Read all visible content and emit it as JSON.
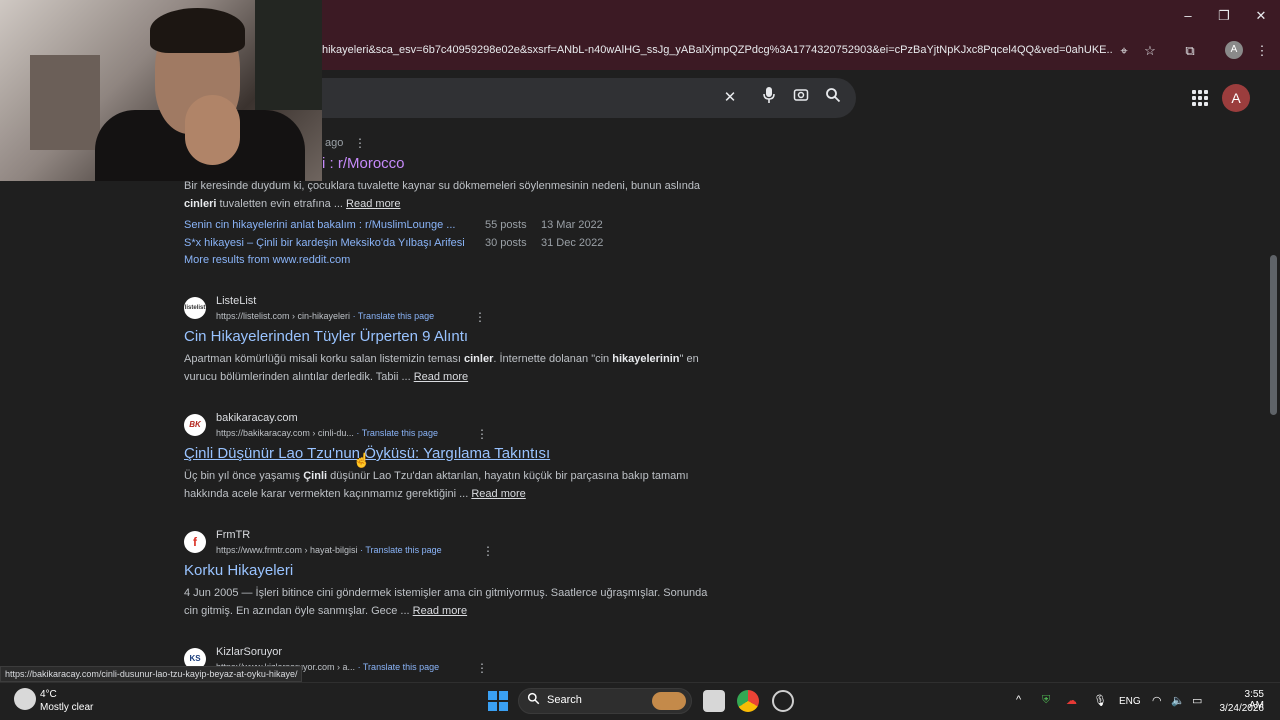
{
  "browser": {
    "url": "hikayeleri&sca_esv=6b7c40959298e02e&sxsrf=ANbL-n40wAlHG_ssJg_yABalXjmpQZPdcg%3A1774320752903&ei=cPzBaYjtNpKJxc8Pqcel4QQ&ved=0ahUKE...",
    "profile_initial": "A",
    "status_url": "https://bakikaracay.com/cinli-dusunur-lao-tzu-kayip-beyaz-at-oyku-hikaye/"
  },
  "header": {
    "avatar_initial": "A"
  },
  "results": {
    "top": {
      "meta": "ago",
      "title": "i : r/Morocco",
      "snippet_html": "Bir keresinde duydum ki, çocuklara tuvalette kaynar su dökmemeleri söylenmesinin nedeni, bunun aslında <b>cinleri</b> tuvaletten evin etrafına ...",
      "read_more": "Read more",
      "sub1_link": "Senin cin hikayelerini anlat bakalım : r/MuslimLounge ...",
      "sub1_posts": "55 posts",
      "sub1_date": "13 Mar 2022",
      "sub2_link": "S*x hikayesi – Çinli bir kardeşin Meksiko'da Yılbaşı Arifesi",
      "sub2_posts": "30 posts",
      "sub2_date": "31 Dec 2022",
      "more": "More results from www.reddit.com"
    },
    "r1": {
      "favicon": "listelist",
      "site": "ListeList",
      "url": "https://listelist.com › cin-hikayeleri",
      "translate": "· Translate this page",
      "title": "Cin Hikayelerinden Tüyler Ürperten 9 Alıntı",
      "snippet_html": "Apartman kömürlüğü misali korku salan listemizin teması <b>cinler</b>. İnternette dolanan \"cin <b>hikayelerinin</b>\" en vurucu bölümlerinden alıntılar derledik. Tabii ...",
      "read_more": "Read more"
    },
    "r2": {
      "favicon": "BK",
      "site": "bakikaracay.com",
      "url": "https://bakikaracay.com › cinli-du...",
      "translate": "· Translate this page",
      "title": "Çinli Düşünür Lao Tzu'nun Öyküsü: Yargılama Takıntısı",
      "snippet_html": "Üç bin yıl önce yaşamış <b>Çinli</b> düşünür Lao Tzu'dan aktarılan, hayatın küçük bir parçasına bakıp tamamı hakkında acele karar vermekten kaçınmamız gerektiğini ...",
      "read_more": "Read more"
    },
    "r3": {
      "favicon": "f",
      "site": "FrmTR",
      "url": "https://www.frmtr.com › hayat-bilgisi",
      "translate": "· Translate this page",
      "title": "Korku Hikayeleri",
      "snippet_html": "4 Jun 2005 — İşleri bitince cini göndermek istemişler ama cin gitmiyormuş. Saatlerce uğraşmışlar. Sonunda cin gitmiş. En azından öyle sanmışlar. Gece ...",
      "read_more": "Read more"
    },
    "r4": {
      "favicon": "KS",
      "site": "KizlarSoruyor",
      "url": "https://www.kizlarsoruyor.com › a...",
      "translate": "· Translate this page"
    }
  },
  "taskbar": {
    "temp": "4°C",
    "weather": "Mostly clear",
    "search_label": "Search",
    "lang": "ENG",
    "time": "3:55 AM",
    "date": "3/24/2026"
  }
}
